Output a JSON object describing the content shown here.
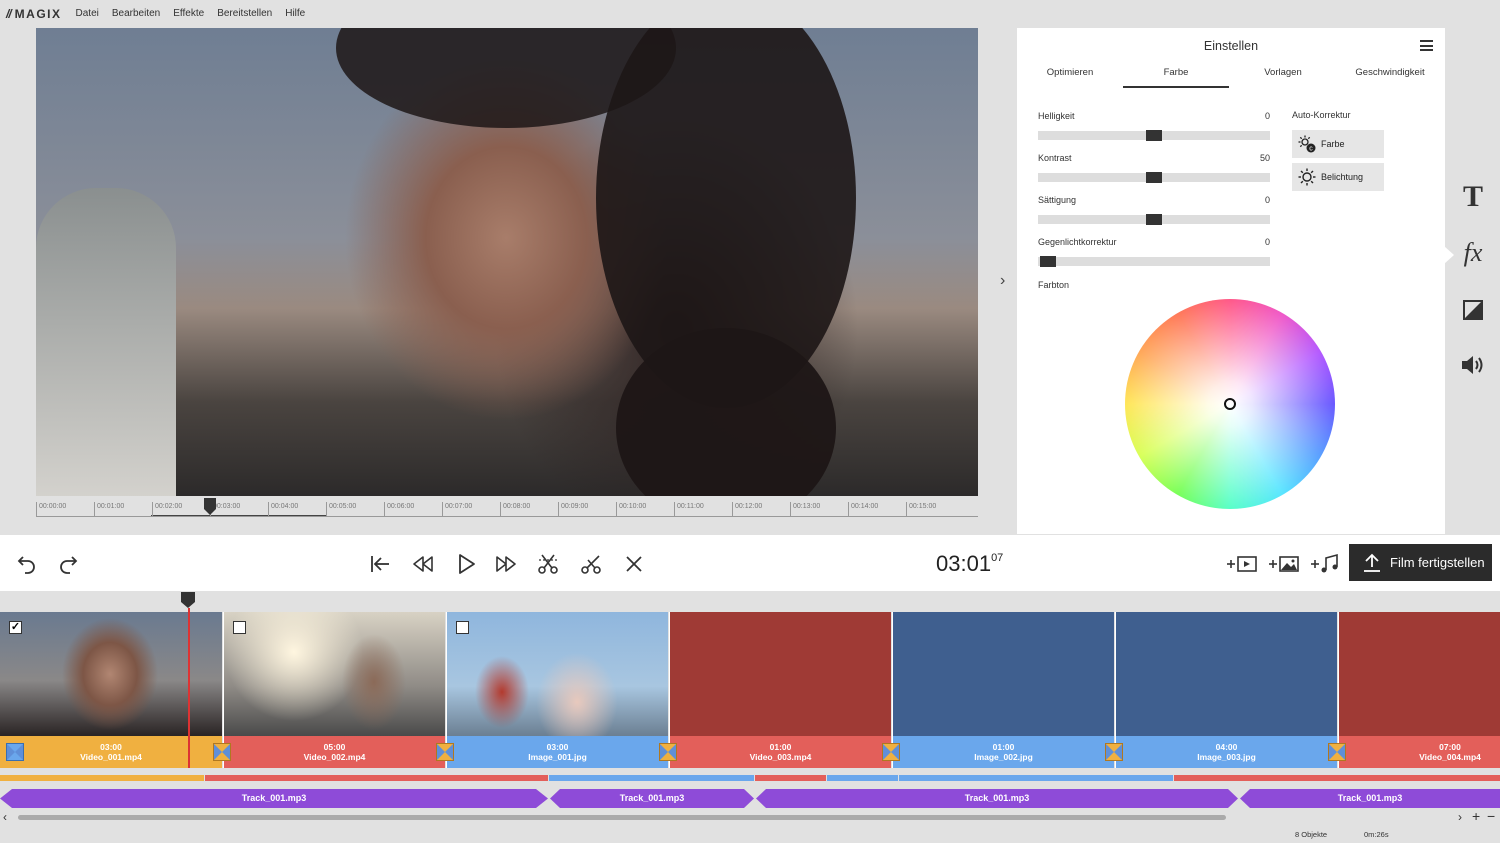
{
  "menubar": {
    "logo": "MAGIX",
    "items": [
      "Datei",
      "Bearbeiten",
      "Effekte",
      "Bereitstellen",
      "Hilfe"
    ]
  },
  "ruler": {
    "ticks": [
      "00:00:00",
      "00:01:00",
      "00:02:00",
      "00:03:00",
      "00:04:00",
      "00:05:00",
      "00:06:00",
      "00:07:00",
      "00:08:00",
      "00:09:00",
      "00:10:00",
      "00:11:00",
      "00:12:00",
      "00:13:00",
      "00:14:00",
      "00:15:00"
    ]
  },
  "panel": {
    "title": "Einstellen",
    "tabs": [
      "Optimieren",
      "Farbe",
      "Vorlagen",
      "Geschwindigkeit"
    ],
    "active_tab": "Farbe",
    "sliders": [
      {
        "label": "Helligkeit",
        "value": "0",
        "position": 0.5
      },
      {
        "label": "Kontrast",
        "value": "50",
        "position": 0.5
      },
      {
        "label": "Sättigung",
        "value": "0",
        "position": 0.5
      },
      {
        "label": "Gegenlichtkorrektur",
        "value": "0",
        "position": 0.0
      }
    ],
    "auto_correction": {
      "label": "Auto-Korrektur",
      "buttons": [
        "Farbe",
        "Belichtung"
      ]
    },
    "hue_label": "Farbton"
  },
  "sidebar_icons": [
    "text-icon",
    "fx-icon",
    "color-correction-icon",
    "volume-icon"
  ],
  "transport": {
    "timecode_main": "03:01",
    "timecode_frames": "07",
    "export_label": "Film fertigstellen"
  },
  "clips": [
    {
      "duration": "03:00",
      "name": "Video_001.mp4",
      "color": "#f0b040",
      "checked": true
    },
    {
      "duration": "05:00",
      "name": "Video_002.mp4",
      "color": "#e35f5a",
      "checked": false
    },
    {
      "duration": "03:00",
      "name": "Image_001.jpg",
      "color": "#6aa7ec",
      "checked": false
    },
    {
      "duration": "01:00",
      "name": "Video_003.mp4",
      "color": "#e35f5a"
    },
    {
      "duration": "01:00",
      "name": "Image_002.jpg",
      "color": "#6aa7ec"
    },
    {
      "duration": "04:00",
      "name": "Image_003.jpg",
      "color": "#6aa7ec"
    },
    {
      "duration": "07:00",
      "name": "Video_004.mp4",
      "color": "#e35f5a"
    }
  ],
  "audio_tracks": [
    "Track_001.mp3",
    "Track_001.mp3",
    "Track_001.mp3",
    "Track_001.mp3"
  ],
  "status": {
    "objects": "8 Objekte",
    "length": "0m:26s"
  },
  "colors": {
    "accent_dark": "#2b2b2b",
    "playhead": "#dd3333",
    "audio": "#8e4bd8"
  }
}
